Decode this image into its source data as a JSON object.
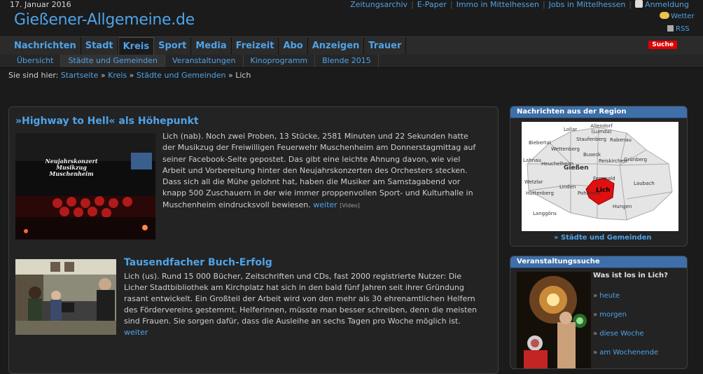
{
  "header": {
    "date": "17. Januar 2016",
    "logo": "Gießener-Allgemeine.de",
    "top_links": [
      "Zeitungsarchiv",
      "E-Paper",
      "Immo in Mittelhessen",
      "Jobs in Mittelhessen"
    ],
    "login": "Anmeldung",
    "weather": "Wetter",
    "rss": "RSS"
  },
  "main_nav": {
    "items": [
      "Nachrichten",
      "Stadt",
      "Kreis",
      "Sport",
      "Media",
      "Freizeit",
      "Abo",
      "Anzeigen",
      "Trauer"
    ],
    "active": "Kreis",
    "search_label": "Suche"
  },
  "sub_nav": {
    "items": [
      "Übersicht",
      "Städte und Gemeinden",
      "Veranstaltungen",
      "Kinoprogramm",
      "Blende 2015"
    ],
    "active": "Städte und Gemeinden"
  },
  "breadcrumb": {
    "prefix": "Sie sind hier:",
    "links": [
      "Startseite",
      "Kreis",
      "Städte und Gemeinden"
    ],
    "current": "Lich"
  },
  "articles": [
    {
      "title": "»Highway to Hell« als Höhepunkt",
      "text": "Lich (nab). Noch zwei Proben, 13 Stücke, 2581 Minuten und 22 Sekunden hatte der Musikzug der Freiwilligen Feuerwehr Muschenheim am Donnerstagmittag auf seiner Facebook-Seite gepostet. Das gibt eine leichte Ahnung davon, wie viel Arbeit und Vorbereitung hinter den Neujahrskonzerten des Orchesters stecken. Dass sich all die Mühe gelohnt hat, haben die Musiker am Samstagabend vor knapp 500 Zuschauern in der wie immer proppenvollen Sport- und Kulturhalle in Muschenheim eindrucksvoll bewiesen.",
      "more": "weiter",
      "tag": "[Video]",
      "image_text": [
        "Neujahrskonzert",
        "Musikzug",
        "Muschenheim"
      ]
    },
    {
      "title": "Tausendfacher Buch-Erfolg",
      "text": "Lich (us). Rund 15 000 Bücher, Zeitschriften und CDs, fast 2000 registrierte Nutzer: Die Licher Stadtbibliothek am Kirchplatz hat sich in den bald fünf Jahren seit ihrer Gründung rasant entwickelt. Ein Großteil der Arbeit wird von den mehr als 30 ehrenamtlichen Helfern des Fördervereins gestemmt. Helferinnen, müsste man besser schreiben, denn die meisten sind Frauen. Sie sorgen dafür, dass die Ausleihe an sechs Tagen pro Woche möglich ist.",
      "more": "weiter"
    }
  ],
  "sidebar": {
    "region": {
      "title": "Nachrichten aus der Region",
      "map_labels": [
        "Lollar",
        "Allendorf (Lumda)",
        "Biebertal",
        "Staufenberg",
        "Rabenau",
        "Wettenberg",
        "Buseck",
        "Lahnau",
        "Heuchelheim",
        "Gießen",
        "Reiskirchen",
        "Grünberg",
        "Wetzlar",
        "Fernwald",
        "Lich",
        "Laubach",
        "Hüttenberg",
        "Linden",
        "Pohlheim",
        "Hungen",
        "Langgöns"
      ],
      "highlight": "Lich",
      "link": "» Städte und Gemeinden"
    },
    "events": {
      "title": "Veranstaltungssuche",
      "question": "Was ist los in Lich?",
      "links": [
        "heute",
        "morgen",
        "diese Woche",
        "am Wochenende"
      ]
    }
  },
  "colors": {
    "background": "#1b1b1b",
    "link": "#4fa3e8",
    "box_header": "#3e6fa8",
    "search_button": "#e10000",
    "map_highlight": "#e01010"
  }
}
